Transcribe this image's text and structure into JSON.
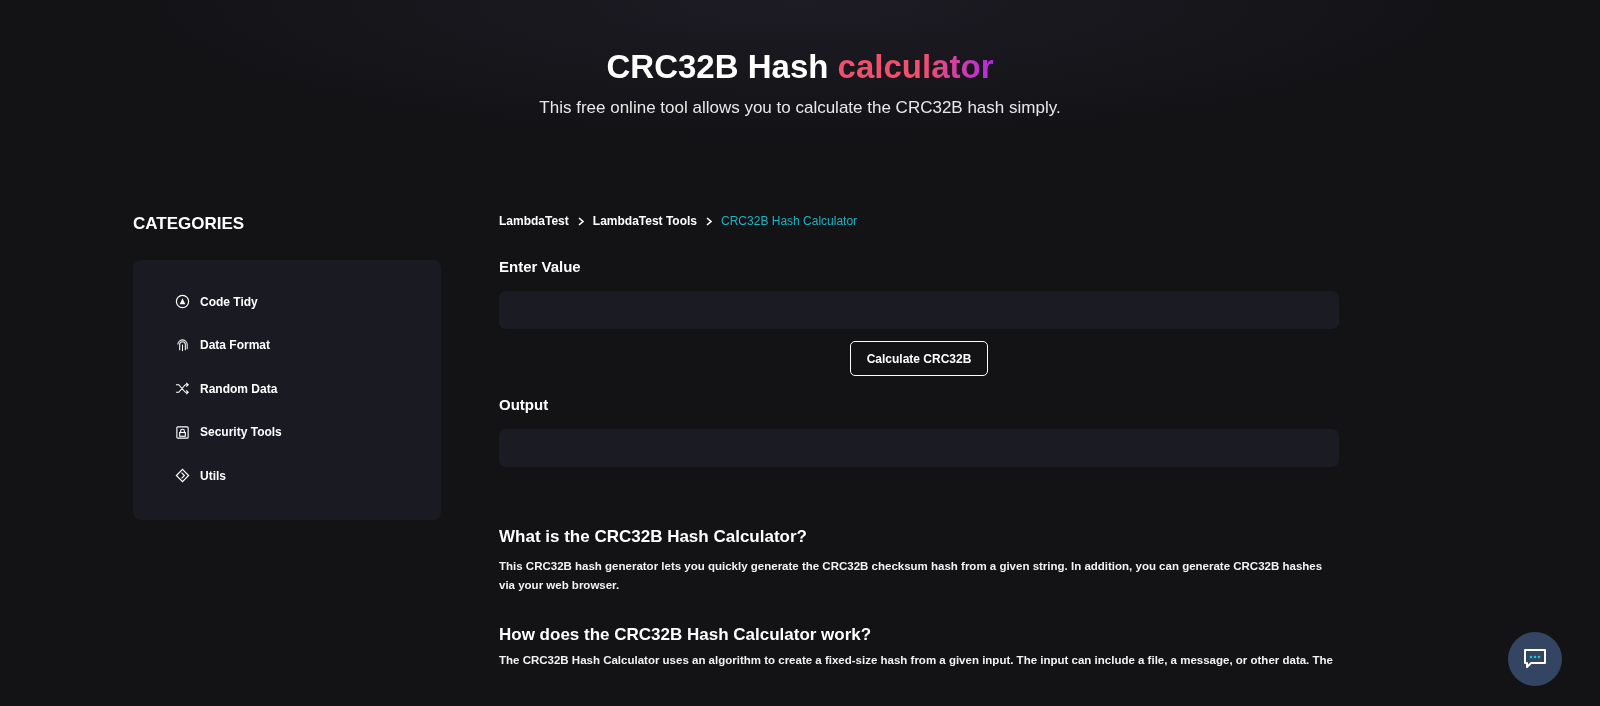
{
  "hero": {
    "title": "CRC32B Hash",
    "title_highlight": "calculator",
    "subtitle": "This free online tool allows you to calculate the CRC32B hash simply."
  },
  "sidebar": {
    "heading": "CATEGORIES",
    "items": [
      {
        "label": "Code Tidy",
        "kind": "code"
      },
      {
        "label": "Data Format",
        "kind": "fingerprint"
      },
      {
        "label": "Random Data",
        "kind": "shuffle"
      },
      {
        "label": "Security Tools",
        "kind": "lock"
      },
      {
        "label": "Utils",
        "kind": "diamond"
      }
    ]
  },
  "breadcrumb": [
    {
      "label": "LambdaTest",
      "selected": false
    },
    {
      "label": "LambdaTest Tools",
      "selected": false
    },
    {
      "label": "CRC32B Hash Calculator",
      "selected": true
    }
  ],
  "input": {
    "label": "Enter Value"
  },
  "button": "Calculate CRC32B",
  "output": {
    "label": "Output"
  },
  "sections": [
    {
      "heading": "What is the CRC32B Hash Calculator?",
      "text": "This CRC32B hash generator lets you quickly generate the CRC32B checksum hash from a given string. In addition, you can generate CRC32B hashes via your web browser."
    },
    {
      "heading": "How does the CRC32B Hash Calculator work?",
      "text": "The CRC32B Hash Calculator uses an algorithm to create a fixed-size hash from a given input. The input can include a file, a message, or other data. The"
    }
  ]
}
